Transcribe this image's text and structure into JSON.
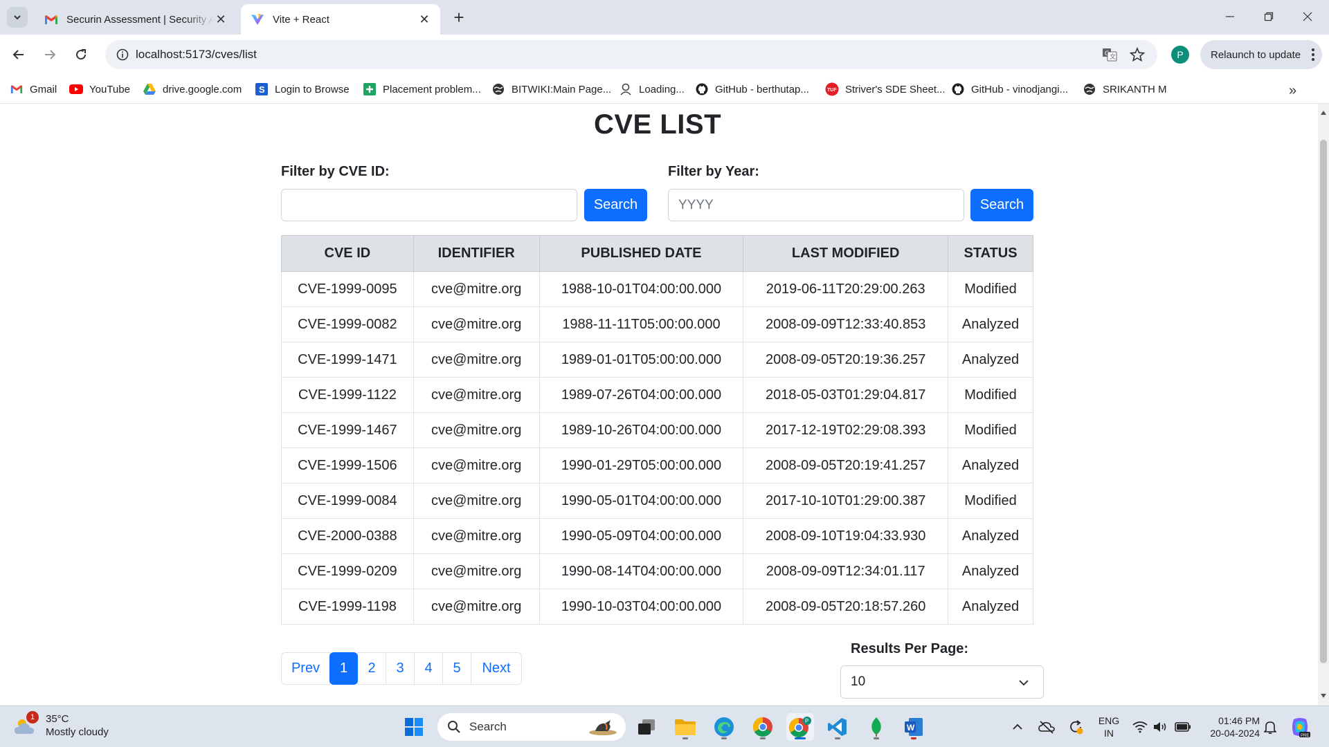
{
  "browser": {
    "tabs": [
      {
        "title": "Securin Assessment | Security A",
        "icon": "gmail-icon",
        "active": false
      },
      {
        "title": "Vite + React",
        "icon": "vite-icon",
        "active": true
      }
    ],
    "url": "localhost:5173/cves/list",
    "relaunch_label": "Relaunch to update",
    "profile_initial": "P",
    "bookmarks": [
      {
        "label": "Gmail",
        "icon": "gmail-icon"
      },
      {
        "label": "YouTube",
        "icon": "youtube-icon"
      },
      {
        "label": "drive.google.com",
        "icon": "drive-icon"
      },
      {
        "label": "Login to Browse",
        "icon": "s-icon"
      },
      {
        "label": "Placement problem...",
        "icon": "plus-doc-icon"
      },
      {
        "label": "BITWIKI:Main Page...",
        "icon": "globe-icon"
      },
      {
        "label": "Loading...",
        "icon": "loading-icon"
      },
      {
        "label": "GitHub - berthutap...",
        "icon": "github-icon"
      },
      {
        "label": "Striver's SDE Sheet...",
        "icon": "tuf-icon"
      },
      {
        "label": "GitHub - vinodjangi...",
        "icon": "github-icon"
      },
      {
        "label": "SRIKANTH M",
        "icon": "globe-icon"
      }
    ]
  },
  "page": {
    "title": "CVE LIST",
    "filter_id": {
      "label": "Filter by CVE ID:",
      "placeholder": "",
      "value": "",
      "button": "Search"
    },
    "filter_year": {
      "label": "Filter by Year:",
      "placeholder": "YYYY",
      "value": "",
      "button": "Search"
    },
    "table": {
      "headers": [
        "CVE ID",
        "IDENTIFIER",
        "PUBLISHED DATE",
        "LAST MODIFIED",
        "STATUS"
      ],
      "rows": [
        [
          "CVE-1999-0095",
          "cve@mitre.org",
          "1988-10-01T04:00:00.000",
          "2019-06-11T20:29:00.263",
          "Modified"
        ],
        [
          "CVE-1999-0082",
          "cve@mitre.org",
          "1988-11-11T05:00:00.000",
          "2008-09-09T12:33:40.853",
          "Analyzed"
        ],
        [
          "CVE-1999-1471",
          "cve@mitre.org",
          "1989-01-01T05:00:00.000",
          "2008-09-05T20:19:36.257",
          "Analyzed"
        ],
        [
          "CVE-1999-1122",
          "cve@mitre.org",
          "1989-07-26T04:00:00.000",
          "2018-05-03T01:29:04.817",
          "Modified"
        ],
        [
          "CVE-1999-1467",
          "cve@mitre.org",
          "1989-10-26T04:00:00.000",
          "2017-12-19T02:29:08.393",
          "Modified"
        ],
        [
          "CVE-1999-1506",
          "cve@mitre.org",
          "1990-01-29T05:00:00.000",
          "2008-09-05T20:19:41.257",
          "Analyzed"
        ],
        [
          "CVE-1999-0084",
          "cve@mitre.org",
          "1990-05-01T04:00:00.000",
          "2017-10-10T01:29:00.387",
          "Modified"
        ],
        [
          "CVE-2000-0388",
          "cve@mitre.org",
          "1990-05-09T04:00:00.000",
          "2008-09-10T19:04:33.930",
          "Analyzed"
        ],
        [
          "CVE-1999-0209",
          "cve@mitre.org",
          "1990-08-14T04:00:00.000",
          "2008-09-09T12:34:01.117",
          "Analyzed"
        ],
        [
          "CVE-1999-1198",
          "cve@mitre.org",
          "1990-10-03T04:00:00.000",
          "2008-09-05T20:18:57.260",
          "Analyzed"
        ]
      ]
    },
    "pagination": {
      "prev": "Prev",
      "next": "Next",
      "pages": [
        "1",
        "2",
        "3",
        "4",
        "5"
      ],
      "current": "1"
    },
    "results_per_page": {
      "label": "Results Per Page:",
      "value": "10"
    }
  },
  "taskbar": {
    "weather": {
      "temp": "35°C",
      "condition": "Mostly cloudy",
      "badge": "1"
    },
    "search_placeholder": "Search",
    "lang": "ENG",
    "region": "IN",
    "time": "01:46 PM",
    "date": "20-04-2024"
  },
  "colors": {
    "primary": "#0d6efd",
    "header_bg": "#dee2e6",
    "tab_strip": "#dfe3eb",
    "taskbar": "#dde4ee"
  }
}
